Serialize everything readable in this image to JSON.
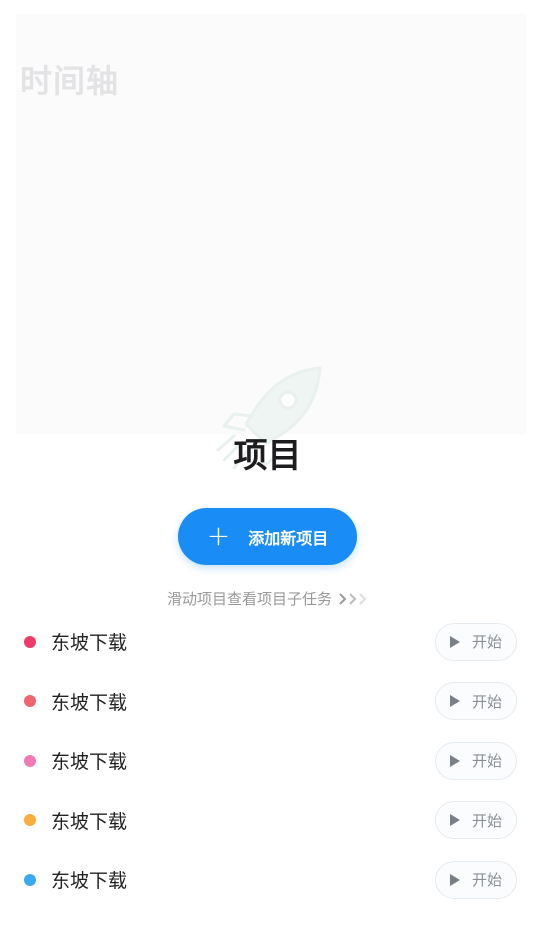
{
  "timeline": {
    "title": "时间轴"
  },
  "header": {
    "title": "项目"
  },
  "add_button": {
    "label": "添加新项目"
  },
  "swipe_hint": {
    "text": "滑动项目查看项目子任务"
  },
  "projects": [
    {
      "name": "东坡下载",
      "color": "#ee3b67",
      "action": "开始"
    },
    {
      "name": "东坡下载",
      "color": "#f06470",
      "action": "开始"
    },
    {
      "name": "东坡下载",
      "color": "#f17ab5",
      "action": "开始"
    },
    {
      "name": "东坡下载",
      "color": "#f9ad3a",
      "action": "开始"
    },
    {
      "name": "东坡下载",
      "color": "#3aaaf0",
      "action": "开始"
    }
  ],
  "colors": {
    "accent": "#1a8cf5"
  }
}
